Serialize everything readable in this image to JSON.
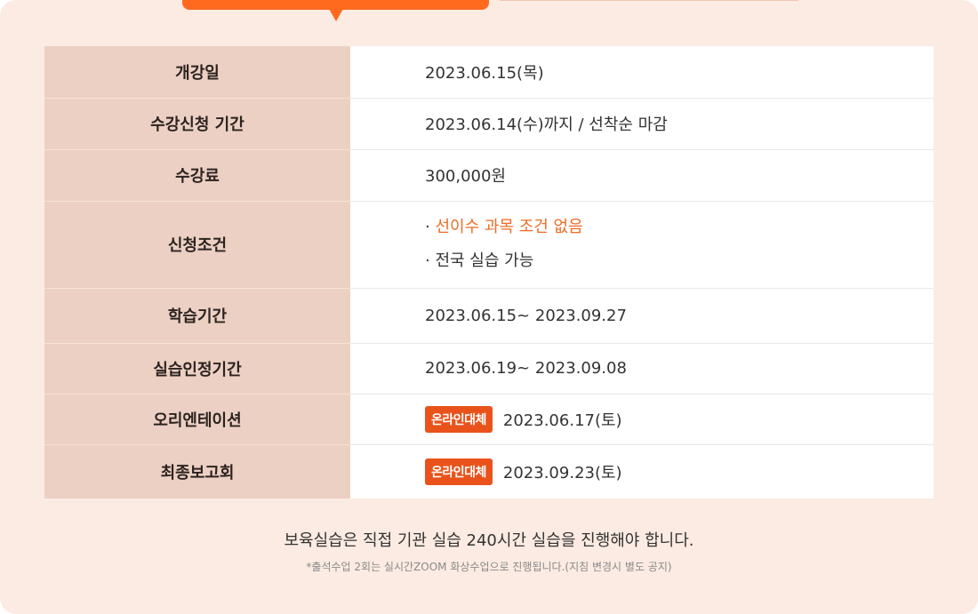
{
  "rows": {
    "opening": {
      "label": "개강일",
      "value": "2023.06.15(목)"
    },
    "registration": {
      "label": "수강신청 기간",
      "value": "2023.06.14(수)까지 / 선착순 마감"
    },
    "fee": {
      "label": "수강료",
      "value": "300,000원"
    },
    "condition": {
      "label": "신청조건",
      "bullet": "·",
      "line1": "선이수 과목 조건 없음",
      "line2": "전국 실습 가능"
    },
    "study_period": {
      "label": "학습기간",
      "value": "2023.06.15~ 2023.09.27"
    },
    "practice_period": {
      "label": "실습인정기간",
      "value": "2023.06.19~ 2023.09.08"
    },
    "orientation": {
      "label": "오리엔테이션",
      "badge": "온라인대체",
      "value": "2023.06.17(토)"
    },
    "final_report": {
      "label": "최종보고회",
      "badge": "온라인대체",
      "value": "2023.09.23(토)"
    }
  },
  "note": {
    "main": "보육실습은 직접 기관 실습 240시간 실습을 진행해야 합니다.",
    "sub": "*출석수업 2회는 실시간ZOOM 화상수업으로 진행됩니다.(지침 변경시 별도 공지)"
  },
  "colors": {
    "accent": "#ff6a1f",
    "highlight_text": "#ef6b25",
    "badge": "#e9531b",
    "header_cell": "#ecd0c3",
    "panel": "#fbebe2"
  }
}
